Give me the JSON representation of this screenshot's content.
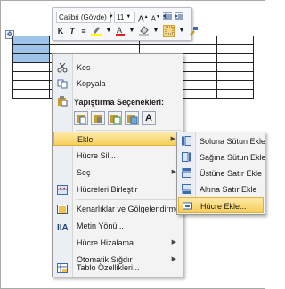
{
  "mini_toolbar": {
    "font_name": "Calibri (Gövde)",
    "font_size": "11",
    "bold": "K",
    "italic": "T",
    "align": "≡",
    "grow_font": "A",
    "shrink_font": "A"
  },
  "context_menu": {
    "cut": "Kes",
    "copy": "Kopyala",
    "paste_options_heading": "Yapıştırma Seçenekleri:",
    "paste_text_only": "A",
    "insert": "Ekle",
    "delete_cells": "Hücre Sil...",
    "select": "Seç",
    "merge_cells": "Hücreleri Birleştir",
    "borders_shading": "Kenarlıklar ve Gölgelendirme...",
    "text_direction": "Metin Yönü...",
    "cell_alignment": "Hücre Hizalama",
    "autofit": "Otomatik Sığdır",
    "table_properties": "Tablo Özellikleri..."
  },
  "insert_submenu": {
    "insert_col_left": "Soluna Sütun Ekle",
    "insert_col_right": "Sağına Sütun Ekle",
    "insert_row_above": "Üstüne Satır Ekle",
    "insert_row_below": "Altına Satır Ekle",
    "insert_cells": "Hücre Ekle..."
  },
  "colors": {
    "selection": "#9fc4ea",
    "highlight": "#f6cf5a",
    "font_color_bar": "#e02020",
    "highlight_bar": "#ffff00"
  }
}
